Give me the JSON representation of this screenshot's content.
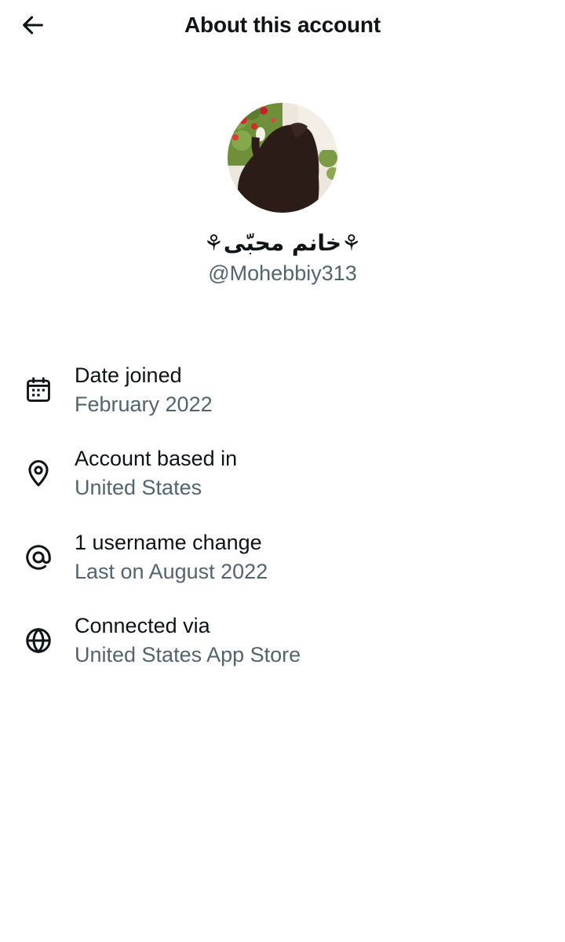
{
  "header": {
    "title": "About this account",
    "back_icon": "arrow-left-icon"
  },
  "profile": {
    "display_name": "⚘خانم محبّی⚘",
    "handle": "@Mohebbiy313"
  },
  "details": [
    {
      "icon": "calendar-icon",
      "label": "Date joined",
      "value": "February 2022"
    },
    {
      "icon": "location-pin-icon",
      "label": "Account based in",
      "value": "United States"
    },
    {
      "icon": "at-sign-icon",
      "label": "1 username change",
      "value": "Last on August 2022"
    },
    {
      "icon": "globe-icon",
      "label": "Connected via",
      "value": "United States App Store"
    }
  ],
  "colors": {
    "primary_text": "#0f1419",
    "secondary_text": "#536471",
    "background": "#ffffff"
  }
}
